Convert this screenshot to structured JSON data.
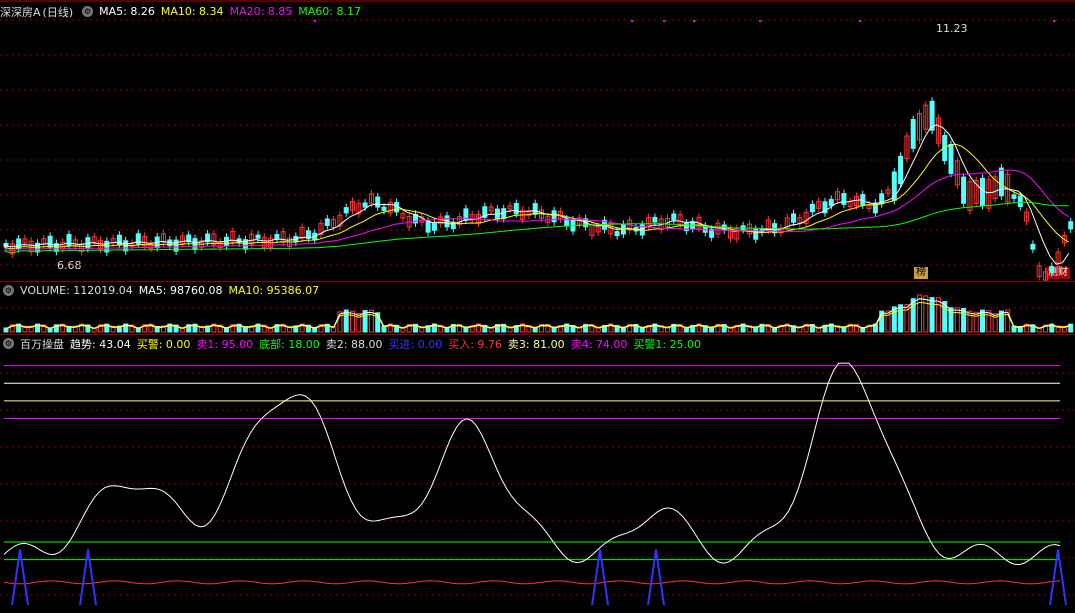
{
  "price_legend": {
    "title": "深深房A",
    "period": "(日线)",
    "ma5": "MA5: 8.26",
    "ma10": "MA10: 8.34",
    "ma20": "MA20: 8.85",
    "ma60": "MA60: 8.17"
  },
  "price_annotations": {
    "high": "11.23",
    "low": "6.68",
    "tag_rank": "榜",
    "tag_finance": "测财"
  },
  "volume_legend": {
    "volume": "VOLUME: 112019.04",
    "ma5": "MA5: 98760.08",
    "ma10": "MA10: 95386.07"
  },
  "indicator_legend": {
    "name": "百万操盘",
    "trend": "趋势: 43.04",
    "alert_buy": "买警: 0.00",
    "sell1": "卖1: 95.00",
    "bottom": "底部: 18.00",
    "sell2": "卖2: 88.00",
    "buy_in": "买进: 0.00",
    "buy_enter": "买入: 9.76",
    "sell3": "卖3: 81.00",
    "sell4": "卖4: 74.00",
    "alert_buy1": "买警1: 25.00"
  },
  "colors": {
    "up": "#ff3232",
    "down": "#54ffff",
    "ma5": "#ffffff",
    "ma10": "#ffff00",
    "ma20": "#ff00ff",
    "ma60": "#00ff00",
    "grid": "#8b0000"
  }
}
